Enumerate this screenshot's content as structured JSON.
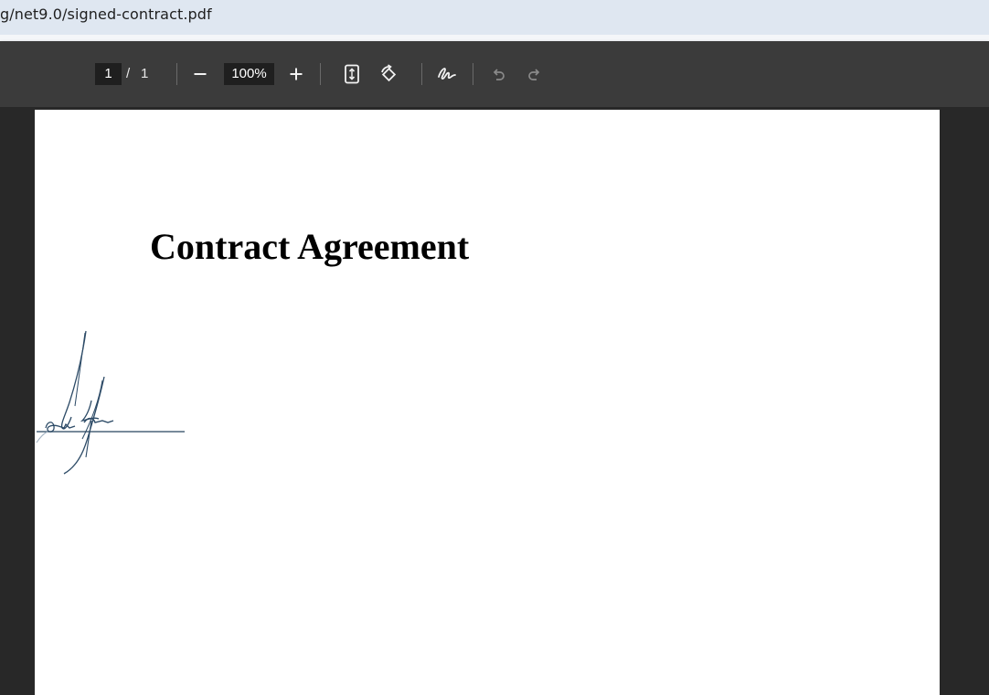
{
  "browser": {
    "address": "g/net9.0/signed-contract.pdf"
  },
  "toolbar": {
    "page_current": "1",
    "page_separator": "/",
    "page_total": "1",
    "zoom": "100%",
    "icons": {
      "zoom_out": "minus-icon",
      "zoom_in": "plus-icon",
      "fit_page": "fit-page-icon",
      "rotate": "rotate-icon",
      "annotate": "draw-icon",
      "undo": "undo-icon",
      "redo": "redo-icon"
    }
  },
  "document": {
    "title": "Contract Agreement",
    "signature": "handwritten signature"
  },
  "colors": {
    "toolbar_bg": "#3b3b3b",
    "viewer_bg": "#282828",
    "page_bg": "#ffffff",
    "ink": "#2c4a66"
  }
}
